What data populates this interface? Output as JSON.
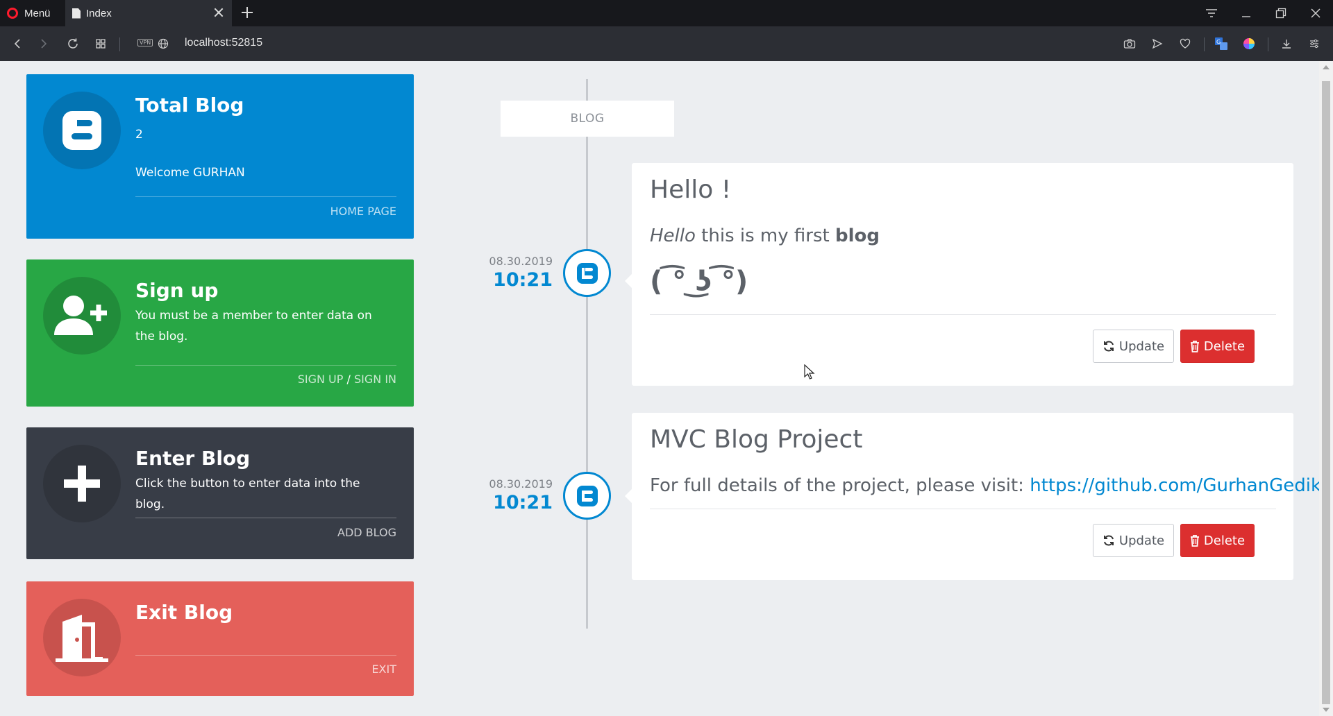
{
  "browser": {
    "menu_label": "Menü",
    "tab_title": "Index",
    "url": "localhost:52815",
    "vpn_badge": "VPN"
  },
  "cards": {
    "total": {
      "title": "Total Blog",
      "count": "2",
      "welcome": "Welcome GURHAN",
      "footer_link": "HOME PAGE",
      "color": "#0288d1"
    },
    "signup": {
      "title": "Sign up",
      "text": "You must be a member to enter data on the blog.",
      "link_signup": "SIGN UP",
      "link_sep": "/",
      "link_signin": "SIGN IN",
      "color": "#28a745"
    },
    "enter": {
      "title": "Enter Blog",
      "text": "Click the button to enter data into the blog.",
      "footer_link": "ADD BLOG",
      "color": "#383d47"
    },
    "exit": {
      "title": "Exit Blog",
      "footer_link": "EXIT",
      "color": "#e4605a"
    }
  },
  "timeline": {
    "header": "BLOG",
    "posts": [
      {
        "date": "08.30.2019",
        "time": "10:21",
        "title": "Hello !",
        "body_italic": "Hello",
        "body_mid": " this is my first ",
        "body_bold": "blog",
        "emoticon": "( ͡° ͜ʖ ͡°)",
        "update_label": "Update",
        "delete_label": "Delete"
      },
      {
        "date": "08.30.2019",
        "time": "10:21",
        "title": "MVC Blog Project",
        "body_text": "For full details of the project, please visit: ",
        "body_link": "https://github.com/GurhanGedik",
        "update_label": "Update",
        "delete_label": "Delete"
      }
    ]
  }
}
